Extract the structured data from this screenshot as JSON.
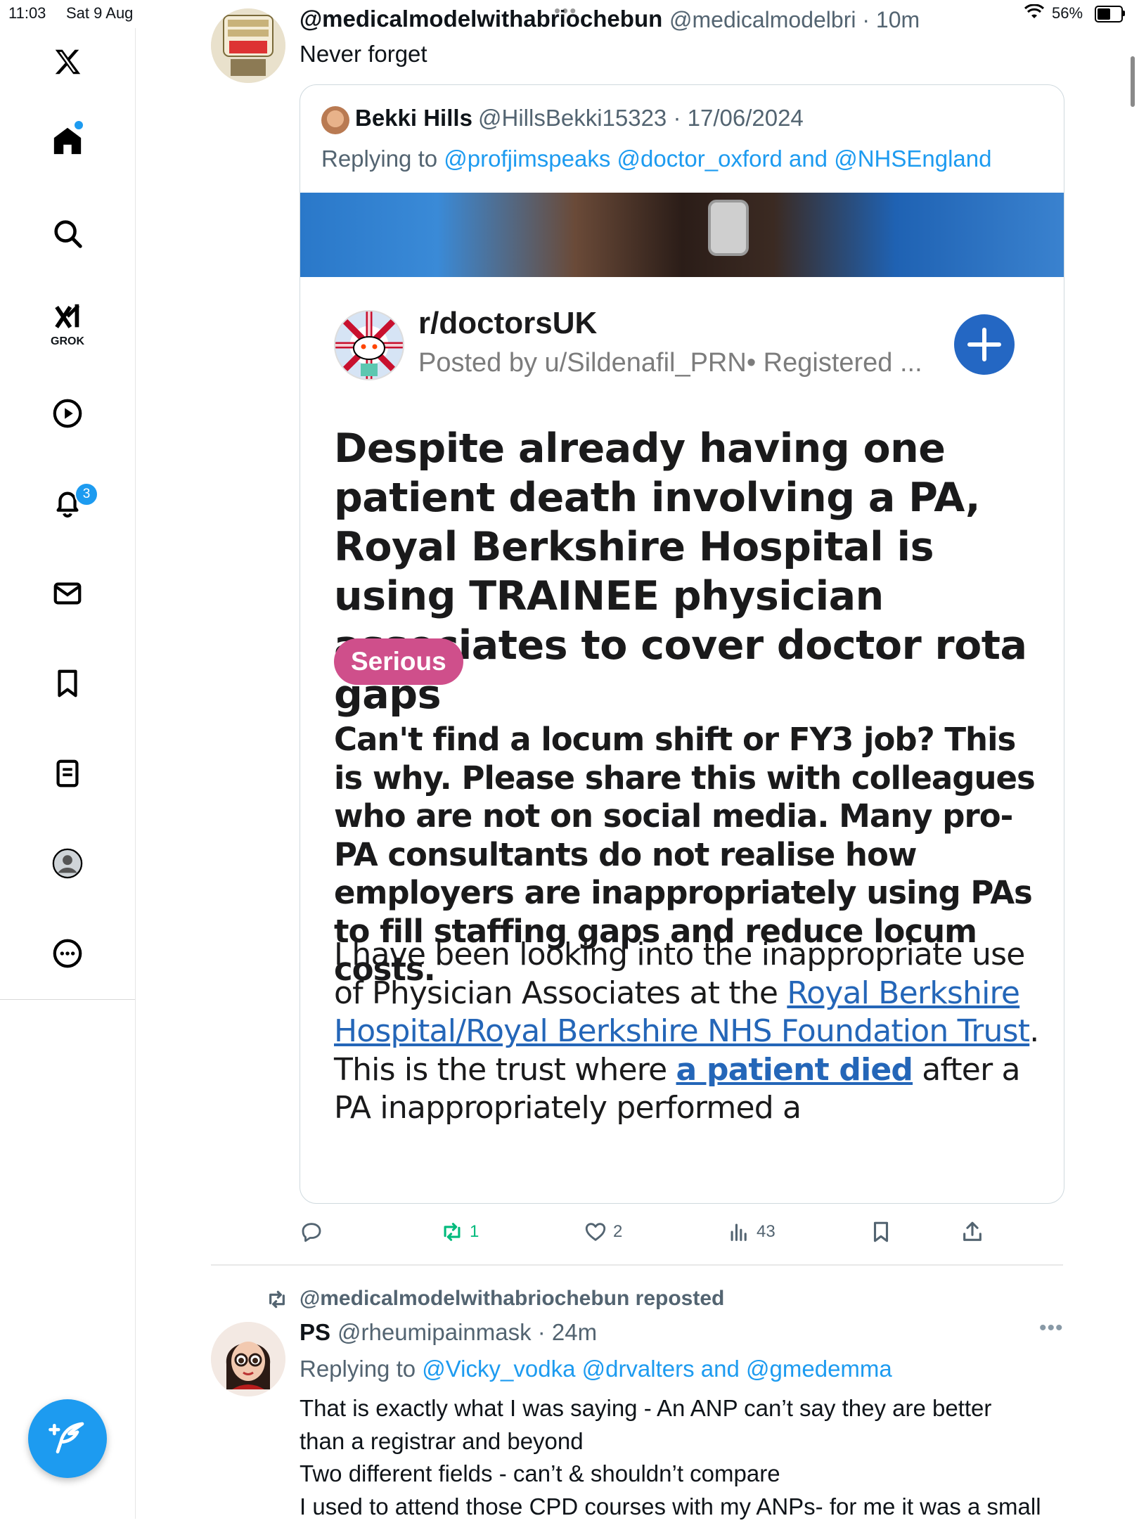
{
  "status_bar": {
    "time": "11:03",
    "date": "Sat 9 Aug",
    "battery": "56%",
    "battery_level": 0.56
  },
  "sidebar": {
    "items": [
      {
        "name": "home",
        "icon": "home-icon"
      },
      {
        "name": "explore",
        "icon": "search-icon"
      },
      {
        "name": "grok",
        "icon": "grok-icon",
        "label": "GROK"
      },
      {
        "name": "video",
        "icon": "play-icon"
      },
      {
        "name": "notifications",
        "icon": "bell-icon",
        "badge": "3"
      },
      {
        "name": "messages",
        "icon": "mail-icon"
      },
      {
        "name": "bookmarks",
        "icon": "bookmark-icon"
      },
      {
        "name": "lists",
        "icon": "list-icon"
      },
      {
        "name": "profile",
        "icon": "profile-icon"
      },
      {
        "name": "more",
        "icon": "more-icon"
      }
    ]
  },
  "tweet1": {
    "display_name": "@medicalmodelwithabriochebun",
    "handle_time": "@medicalmodelbri · 10m",
    "text": "Never forget",
    "quote": {
      "name": "Bekki Hills",
      "handle_date": "@HillsBekki15323 · 17/06/2024",
      "replying_prefix": "Replying to ",
      "replying_to": "@profjimspeaks @doctor_oxford and @NHSEngland",
      "reddit": {
        "subreddit": "r/doctorsUK",
        "posted_by": "Posted by u/Sildenafil_PRN• Registered ...",
        "title": "Despite already having one patient death involving a PA, Royal Berkshire Hospital is using TRAINEE physician associates to cover doctor rota gaps",
        "flair": "Serious",
        "bold_text": "Can't find a locum shift or FY3 job? This is why. Please share this with colleagues who are not on social media. Many pro-PA consultants do not realise how employers are inappropriately using PAs to fill staffing gaps and reduce locum costs.",
        "body_1": "I have been looking into the inappropriate use of Physician Associates at the ",
        "body_link_1": "Royal Berkshire Hospital/Royal Berkshire NHS Foundation Trust",
        "body_2": ". This is the trust where ",
        "body_link_2": "a patient died",
        "body_3": " after a PA inappropriately performed a"
      }
    },
    "actions": {
      "reposts": "1",
      "likes": "2",
      "views": "43"
    }
  },
  "tweet2": {
    "repost_label": "@medicalmodelwithabriochebun reposted",
    "display_name": "PS",
    "handle_time": "@rheumipainmask · 24m",
    "replying_prefix": "Replying to ",
    "replying_to": "@Vicky_vodka @drvalters and @gmedemma",
    "lines": [
      "That is exactly what I was saying - An ANP can’t say they are better",
      "than a registrar and beyond",
      "Two different fields - can’t & shouldn’t compare",
      "I used to attend those CPD courses with my ANPs- for me it was a small"
    ]
  }
}
